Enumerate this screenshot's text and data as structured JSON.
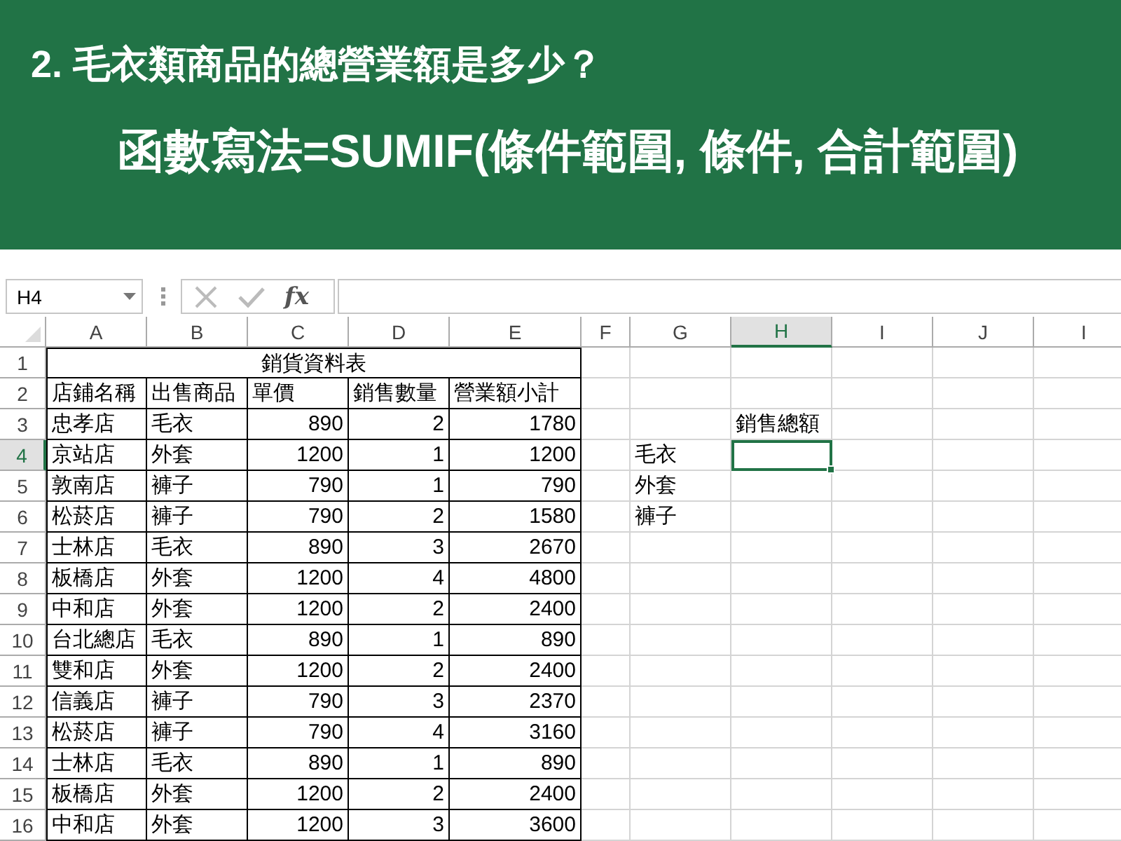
{
  "banner": {
    "question": "2. 毛衣類商品的總營業額是多少？",
    "formula": "函數寫法=SUMIF(條件範圍, 條件, 合計範圍)"
  },
  "formula_bar": {
    "name_box": "H4",
    "function_label": "fx"
  },
  "sheet": {
    "columns": [
      {
        "label": "A",
        "selected": false,
        "kind": "text",
        "bordered": true
      },
      {
        "label": "B",
        "selected": false,
        "kind": "text",
        "bordered": true
      },
      {
        "label": "C",
        "selected": false,
        "kind": "number",
        "bordered": true
      },
      {
        "label": "D",
        "selected": false,
        "kind": "number",
        "bordered": true
      },
      {
        "label": "E",
        "selected": false,
        "kind": "number",
        "bordered": true
      },
      {
        "label": "F",
        "selected": false,
        "kind": "text",
        "bordered": false
      },
      {
        "label": "G",
        "selected": false,
        "kind": "text",
        "bordered": false
      },
      {
        "label": "H",
        "selected": true,
        "kind": "text",
        "bordered": false
      },
      {
        "label": "I",
        "selected": false,
        "kind": "text",
        "bordered": false
      },
      {
        "label": "J",
        "selected": false,
        "kind": "text",
        "bordered": false
      },
      {
        "label": "I",
        "selected": false,
        "kind": "text",
        "bordered": false
      }
    ],
    "rows": [
      {
        "number": "1",
        "selected": false,
        "kind": "title",
        "title": "銷貨資料表"
      },
      {
        "number": "2",
        "selected": false,
        "kind": "header",
        "cells": [
          "店鋪名稱",
          "出售商品",
          "單價",
          "銷售數量",
          "營業額小計"
        ]
      },
      {
        "number": "3",
        "selected": false,
        "kind": "data",
        "cells": [
          "忠孝店",
          "毛衣",
          "890",
          "2",
          "1780",
          null,
          null,
          "銷售總額"
        ]
      },
      {
        "number": "4",
        "selected": true,
        "kind": "data",
        "cells": [
          "京站店",
          "外套",
          "1200",
          "1",
          "1200",
          null,
          "毛衣"
        ]
      },
      {
        "number": "5",
        "selected": false,
        "kind": "data",
        "cells": [
          "敦南店",
          "褲子",
          "790",
          "1",
          "790",
          null,
          "外套"
        ]
      },
      {
        "number": "6",
        "selected": false,
        "kind": "data",
        "cells": [
          "松菸店",
          "褲子",
          "790",
          "2",
          "1580",
          null,
          "褲子"
        ]
      },
      {
        "number": "7",
        "selected": false,
        "kind": "data",
        "cells": [
          "士林店",
          "毛衣",
          "890",
          "3",
          "2670"
        ]
      },
      {
        "number": "8",
        "selected": false,
        "kind": "data",
        "cells": [
          "板橋店",
          "外套",
          "1200",
          "4",
          "4800"
        ]
      },
      {
        "number": "9",
        "selected": false,
        "kind": "data",
        "cells": [
          "中和店",
          "外套",
          "1200",
          "2",
          "2400"
        ]
      },
      {
        "number": "10",
        "selected": false,
        "kind": "data",
        "cells": [
          "台北總店",
          "毛衣",
          "890",
          "1",
          "890"
        ]
      },
      {
        "number": "11",
        "selected": false,
        "kind": "data",
        "cells": [
          "雙和店",
          "外套",
          "1200",
          "2",
          "2400"
        ]
      },
      {
        "number": "12",
        "selected": false,
        "kind": "data",
        "cells": [
          "信義店",
          "褲子",
          "790",
          "3",
          "2370"
        ]
      },
      {
        "number": "13",
        "selected": false,
        "kind": "data",
        "cells": [
          "松菸店",
          "褲子",
          "790",
          "4",
          "3160"
        ]
      },
      {
        "number": "14",
        "selected": false,
        "kind": "data",
        "cells": [
          "士林店",
          "毛衣",
          "890",
          "1",
          "890"
        ]
      },
      {
        "number": "15",
        "selected": false,
        "kind": "data",
        "cells": [
          "板橋店",
          "外套",
          "1200",
          "2",
          "2400"
        ]
      },
      {
        "number": "16",
        "selected": false,
        "kind": "data",
        "cells": [
          "中和店",
          "外套",
          "1200",
          "3",
          "3600"
        ]
      }
    ]
  }
}
